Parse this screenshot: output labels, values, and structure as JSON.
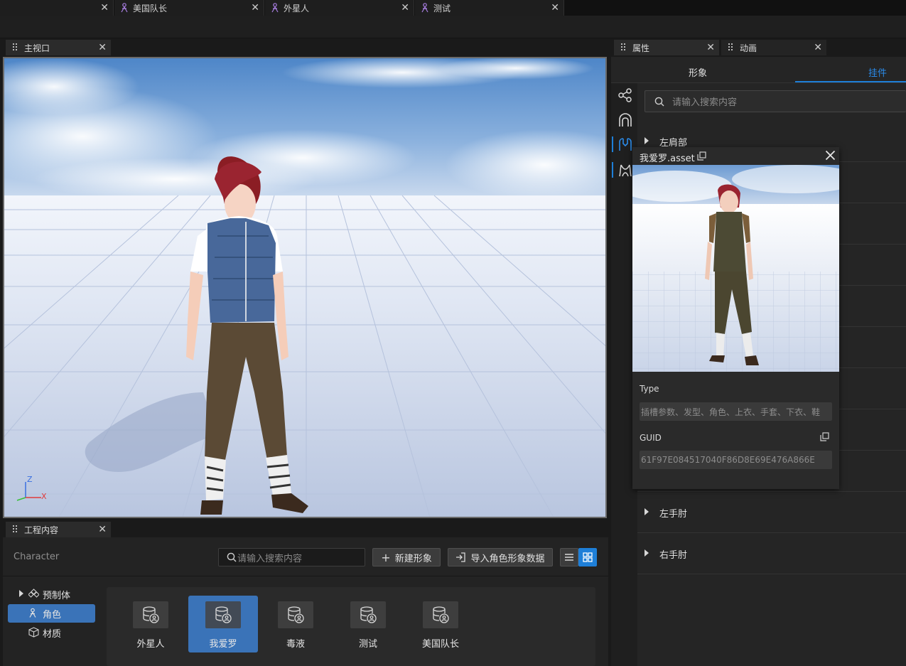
{
  "doc_tabs": [
    {
      "label": ""
    },
    {
      "label": "美国队长"
    },
    {
      "label": "外星人"
    },
    {
      "label": "测试"
    }
  ],
  "viewport": {
    "tab_label": "主视口",
    "axis_z": "Z",
    "axis_x": "X"
  },
  "properties": {
    "tab_label": "属性",
    "anim_tab_label": "动画",
    "subtabs": [
      "形象",
      "挂件"
    ],
    "search_placeholder": "请输入搜索内容",
    "rows": [
      "左肩部",
      "左手肘",
      "右手肘"
    ]
  },
  "popup": {
    "title": "我爱罗.asset",
    "type_label": "Type",
    "type_value": "插槽参数、发型、角色、上衣、手套、下衣、鞋",
    "guid_label": "GUID",
    "guid_value": "61F97E084517040F86D8E69E476A866E"
  },
  "project": {
    "tab_label": "工程内容",
    "breadcrumb": "Character",
    "search_placeholder": "请输入搜索内容",
    "new_button": "新建形象",
    "import_button": "导入角色形象数据",
    "tree": [
      "预制体",
      "角色",
      "材质"
    ],
    "assets": [
      "外星人",
      "我爱罗",
      "毒液",
      "测试",
      "美国队长"
    ]
  },
  "colors": {
    "accent": "#1e7fd8",
    "selected": "#3a73b8"
  }
}
